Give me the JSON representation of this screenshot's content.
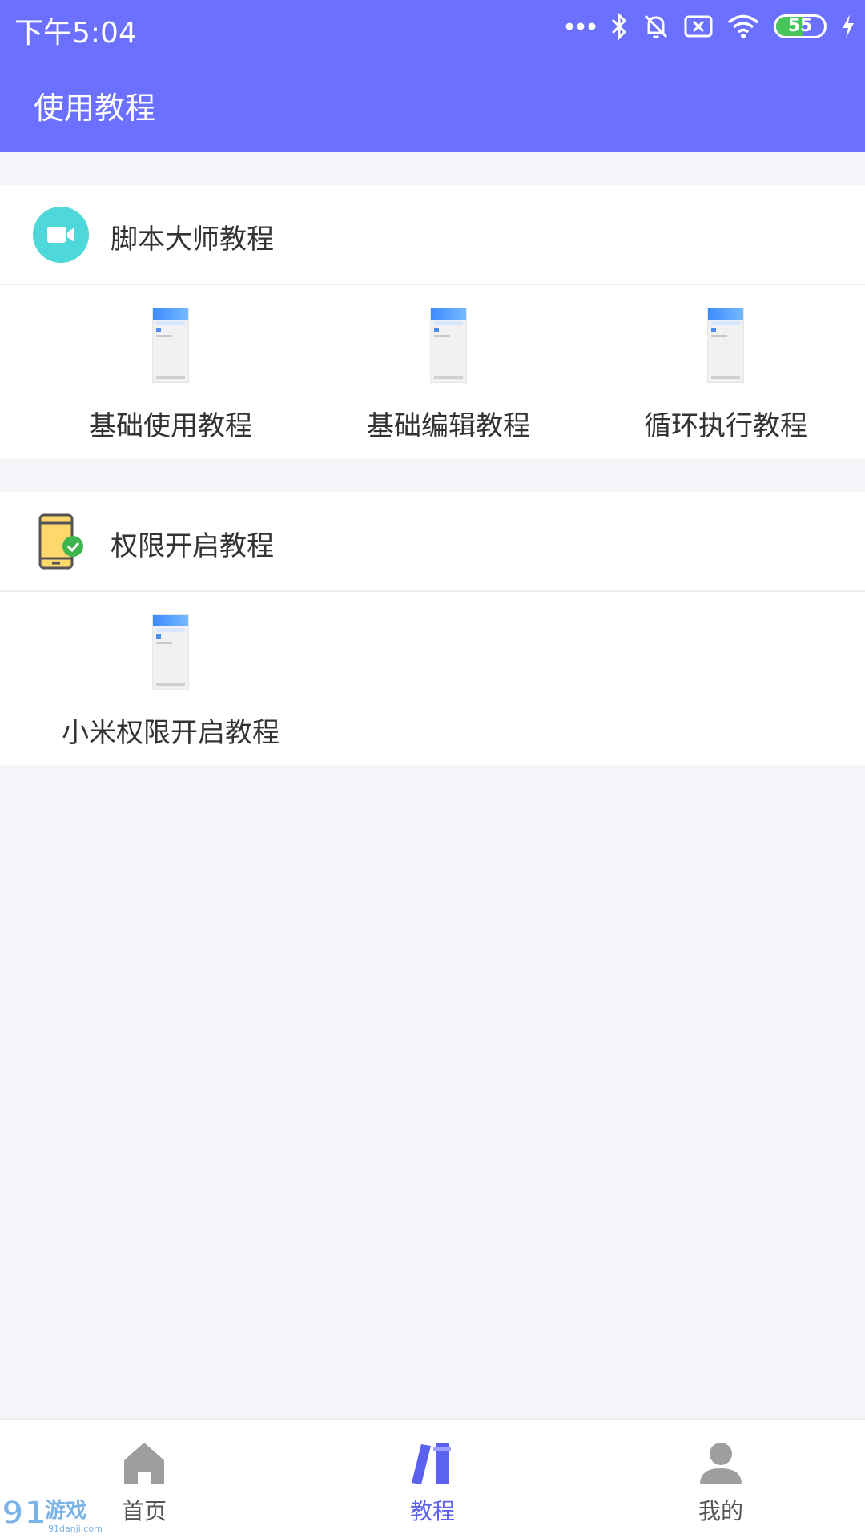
{
  "status_bar": {
    "time": "下午5:04",
    "battery_level": 55,
    "battery_text": "55",
    "icons": [
      "more-icon",
      "bluetooth-icon",
      "bell-muted-icon",
      "sim-icon",
      "wifi-icon",
      "battery-icon",
      "charging-icon"
    ]
  },
  "header": {
    "title": "使用教程"
  },
  "sections": [
    {
      "title": "脚本大师教程",
      "icon": "video-camera-icon",
      "items": [
        {
          "label": "基础使用教程"
        },
        {
          "label": "基础编辑教程"
        },
        {
          "label": "循环执行教程"
        }
      ]
    },
    {
      "title": "权限开启教程",
      "icon": "phone-check-icon",
      "items": [
        {
          "label": "小米权限开启教程"
        }
      ]
    }
  ],
  "bottom_nav": {
    "items": [
      {
        "label": "首页",
        "icon": "home-icon",
        "active": false
      },
      {
        "label": "教程",
        "icon": "books-icon",
        "active": true
      },
      {
        "label": "我的",
        "icon": "person-icon",
        "active": false
      }
    ]
  },
  "colors": {
    "primary": "#6c70ff",
    "active_nav": "#5b62f0",
    "background": "#f6f3f9",
    "camera_icon_bg": "#4fd8d9"
  }
}
